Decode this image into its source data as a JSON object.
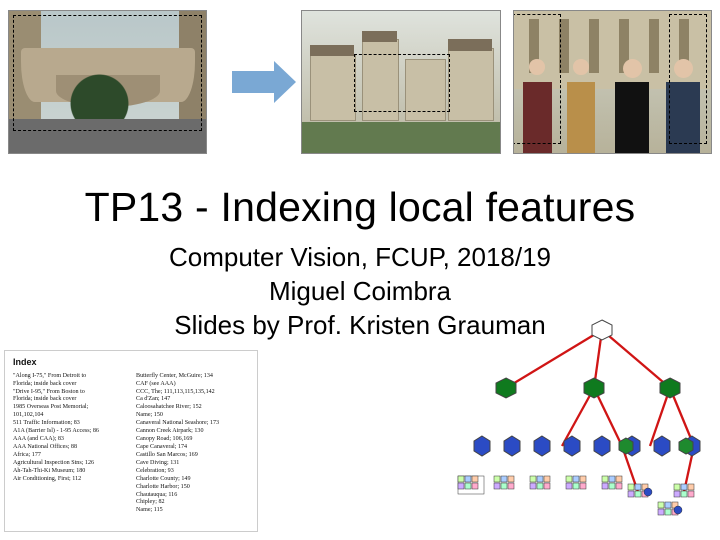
{
  "title": "TP13 - Indexing local features",
  "subtitle_line1": "Computer Vision, FCUP, 2018/19",
  "subtitle_line2": "Miguel Coimbra",
  "subtitle_line3": "Slides by Prof. Kristen Grauman",
  "index_panel": {
    "heading": "Index",
    "left_column": "\"Along I-75,\" From Detroit to\n  Florida; inside back cover\n\"Drive I-95,\" From Boston to\n  Florida; inside back cover\n1985 Overseas Post Memorial;\n  101,102,104\n511 Traffic Information; 83\nA1A (Barrier Isl) - 1-95 Access; 86\nAAA (and CAA); 83\nAAA National Offices; 88\nAfrica; 177\nAgricultural Inspection Stns; 126\nAh-Tah-Thi-Ki Museum; 180\nAir Conditioning, First; 112",
    "right_column": "Butterfly Center, McGuire; 134\nCAF (see AAA)\nCCC, The; 111,113,115,135,142\nCa d'Zan; 147\nCaloosahatchee River; 152\n  Name; 150\nCanaveral National Seashore; 173\nCannon Creek Airpark; 130\nCanopy Road; 106,169\nCape Canaveral; 174\nCastillo San Marcos; 169\nCave Diving; 131\nCelebration; 93\nCharlotte County; 149\nCharlotte Harbor; 150\nChautauqua; 116\nChipley; 82\n  Name; 115"
  },
  "images": {
    "img1_alt": "bridge-photo",
    "img2_alt": "miniature-city-photo",
    "img3_alt": "group-photo"
  }
}
